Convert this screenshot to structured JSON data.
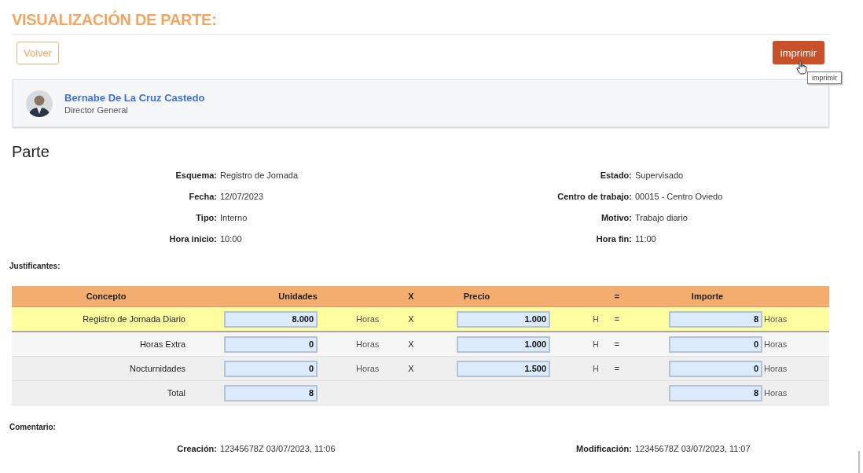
{
  "page_title": "VISUALIZACIÓN DE PARTE:",
  "toolbar": {
    "back_button": "Volver",
    "print_button": "imprimir",
    "tooltip": "imprimir"
  },
  "person": {
    "name": "Bernabe De La Cruz Castedo",
    "role": "Director General"
  },
  "section_title": "Parte",
  "fields": [
    {
      "label": "Esquema:",
      "value": "Registro de Jornada"
    },
    {
      "label": "Estado:",
      "value": "Supervisado"
    },
    {
      "label": "Fecha:",
      "value": "12/07/2023"
    },
    {
      "label": "Centro de trabajo:",
      "value": "00015 - Centro Oviedo"
    },
    {
      "label": "Tipo:",
      "value": "Interno"
    },
    {
      "label": "Motivo:",
      "value": "Trabajo diario"
    },
    {
      "label": "Hora inicio:",
      "value": "10:00"
    },
    {
      "label": "Hora fin:",
      "value": "11:00"
    }
  ],
  "justificantes_label": "Justificantes:",
  "table": {
    "columns": [
      "Concepto",
      "Unidades",
      "X",
      "Precio",
      "=",
      "Importe"
    ],
    "rows": [
      {
        "kind": "item",
        "selected": true,
        "concept": "Registro de Jornada Diario",
        "units": "8.000",
        "units_label": "Horas",
        "times": "X",
        "price": "1.000",
        "price_unit": "H",
        "equals": "=",
        "amount": "8",
        "amount_unit": "Horas"
      },
      {
        "kind": "item",
        "selected": false,
        "concept": "Horas Extra",
        "units": "0",
        "units_label": "Horas",
        "times": "X",
        "price": "1.000",
        "price_unit": "H",
        "equals": "=",
        "amount": "0",
        "amount_unit": "Horas"
      },
      {
        "kind": "item",
        "selected": false,
        "concept": "Nocturnidades",
        "units": "0",
        "units_label": "Horas",
        "times": "X",
        "price": "1.500",
        "price_unit": "H",
        "equals": "=",
        "amount": "0",
        "amount_unit": "Horas"
      },
      {
        "kind": "total",
        "selected": false,
        "concept": "Total",
        "units": "8",
        "amount": "8",
        "amount_unit": "Horas"
      }
    ]
  },
  "comment_label": "Comentario:",
  "audit": [
    {
      "label": "Creación:",
      "value": "12345678Z 03/07/2023, 11:06"
    },
    {
      "label": "Modificación:",
      "value": "12345678Z 03/07/2023, 11:07"
    }
  ]
}
